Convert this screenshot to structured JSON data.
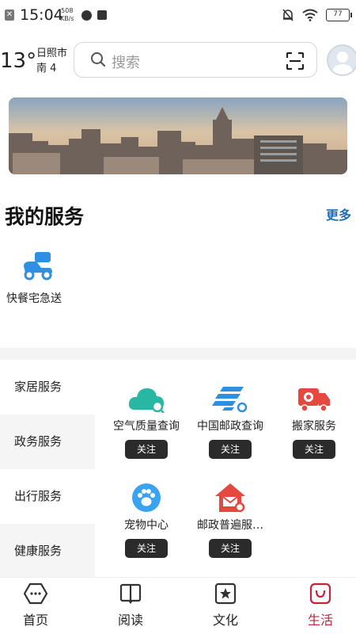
{
  "status_bar": {
    "time": "15:04",
    "net_speed_value": "508",
    "net_speed_unit": "KB/s",
    "battery": "77"
  },
  "weather": {
    "temperature": "13°",
    "city": "日照市",
    "wind": "南 4"
  },
  "search": {
    "placeholder": "搜索"
  },
  "my_services": {
    "title": "我的服务",
    "more": "更多",
    "items": [
      {
        "label": "快餐宅急送",
        "icon": "scooter-icon"
      }
    ]
  },
  "categories": [
    {
      "label": "家居服务",
      "active": false
    },
    {
      "label": "政务服务",
      "active": true
    },
    {
      "label": "出行服务",
      "active": false
    },
    {
      "label": "健康服务",
      "active": true
    }
  ],
  "service_tiles": [
    {
      "name": "空气质量查询",
      "icon": "cloud-icon",
      "color": "#29b7a3",
      "follow": "关注"
    },
    {
      "name": "中国邮政查询",
      "icon": "post-icon",
      "color": "#2d8fe0",
      "follow": "关注"
    },
    {
      "name": "搬家服务",
      "icon": "truck-icon",
      "color": "#e5483f",
      "follow": "关注"
    },
    {
      "name": "宠物中心",
      "icon": "paw-icon",
      "color": "#3aa3ef",
      "follow": "关注"
    },
    {
      "name": "邮政普遍服…",
      "icon": "house-mail-icon",
      "color": "#e5483f",
      "follow": "关注"
    }
  ],
  "bottom_nav": [
    {
      "label": "首页",
      "icon": "home-icon",
      "active": false
    },
    {
      "label": "阅读",
      "icon": "book-icon",
      "active": false
    },
    {
      "label": "文化",
      "icon": "star-badge-icon",
      "active": false
    },
    {
      "label": "生活",
      "icon": "bag-icon",
      "active": true
    }
  ],
  "colors": {
    "accent": "#c4233d",
    "link": "#1d6fb8",
    "follow_button": "#2b2b2b"
  }
}
